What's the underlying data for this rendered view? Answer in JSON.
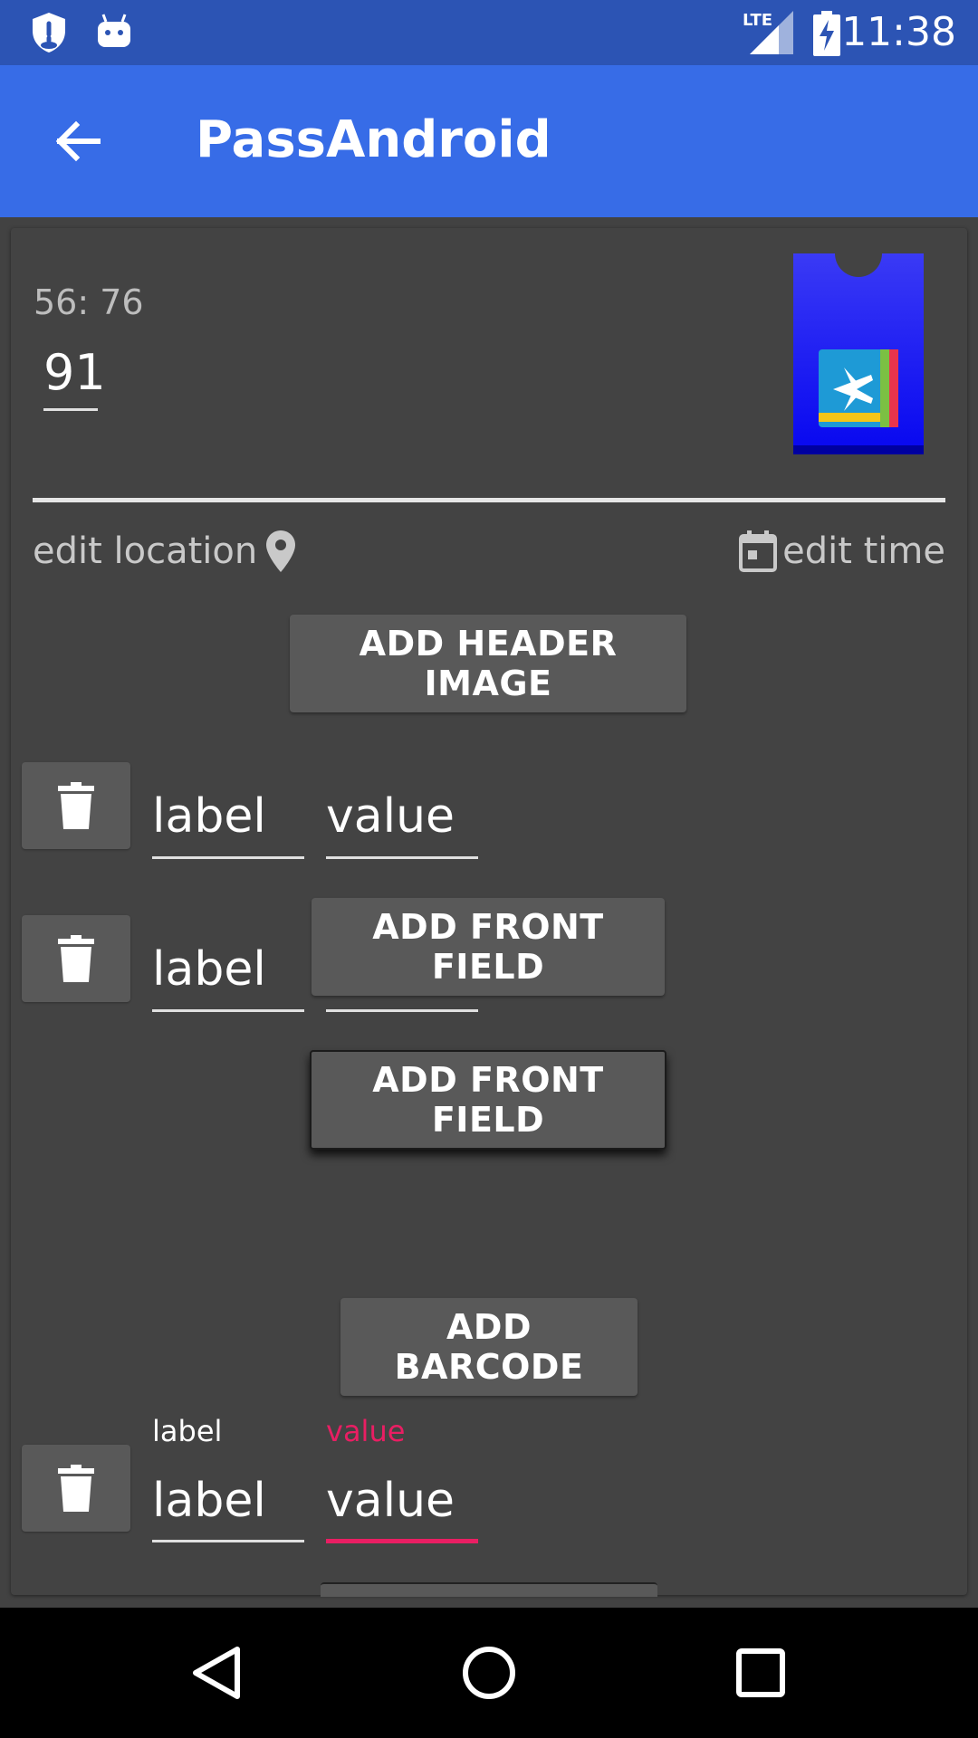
{
  "status_bar": {
    "time": "11:38",
    "network": "LTE",
    "icons": [
      "shield-icon",
      "android-icon",
      "lte-signal-icon",
      "battery-charging-icon"
    ]
  },
  "app_bar": {
    "title": "PassAndroid",
    "back_icon": "arrow-back-icon"
  },
  "pass": {
    "header_label": "56: 76",
    "header_value": "91",
    "edit_location": "edit location",
    "edit_time": "edit time",
    "pass_icon": "boarding-pass-icon"
  },
  "buttons": {
    "add_header_image": "ADD HEADER IMAGE",
    "add_front_field_overlay": "ADD FRONT FIELD",
    "add_front_field": "ADD FRONT FIELD",
    "add_barcode": "ADD BARCODE"
  },
  "front_fields": [
    {
      "label": "label",
      "value": "value"
    },
    {
      "label": "label",
      "value": ""
    }
  ],
  "back_field": {
    "label_caption": "label",
    "value_caption": "value",
    "label": "label",
    "value": "value",
    "accent": "#e91e63"
  },
  "colors": {
    "status_bar": "#2c54b4",
    "app_bar": "#376ce7",
    "card": "#434343"
  }
}
